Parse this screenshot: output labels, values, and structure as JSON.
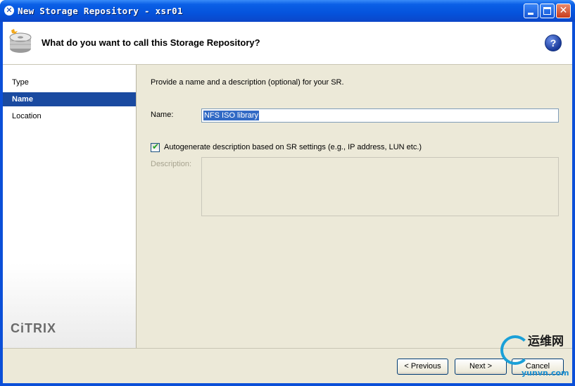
{
  "window": {
    "title": "New Storage Repository - xsr01",
    "title_icon_glyph": "✕"
  },
  "header": {
    "title": "What do you want to call this Storage Repository?",
    "icon": "storage-disk-icon",
    "help_glyph": "?"
  },
  "nav": {
    "items": [
      {
        "label": "Type",
        "selected": false
      },
      {
        "label": "Name",
        "selected": true
      },
      {
        "label": "Location",
        "selected": false
      }
    ],
    "logo": "CiTRIX"
  },
  "form": {
    "intro": "Provide a name and a description (optional) for your SR.",
    "name_label": "Name:",
    "name_value": "NFS ISO library",
    "autogen_checked": true,
    "autogen_label": "Autogenerate description based on SR settings (e.g., IP address, LUN etc.)",
    "description_label": "Description:",
    "description_value": ""
  },
  "footer": {
    "previous_label": "< Previous",
    "next_label": "Next >",
    "cancel_label": "Cancel"
  },
  "watermark": {
    "cn": "运维网",
    "url": "yunvn.com"
  },
  "colors": {
    "titlebar": "#0553dc",
    "nav_selected": "#1a4aa0",
    "selection": "#316ac5",
    "panel": "#ece9d8"
  }
}
